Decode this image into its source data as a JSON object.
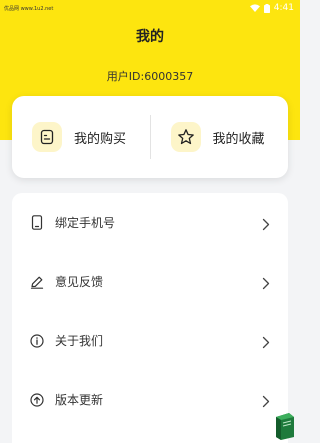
{
  "status_bar": {
    "left_text": "优品网 www.1u2.net",
    "time": "4:41"
  },
  "header": {
    "title": "我的",
    "user_id": "用户ID:6000357"
  },
  "quick_actions": [
    {
      "label": "我的购买",
      "icon": "purchase-icon"
    },
    {
      "label": "我的收藏",
      "icon": "star-icon"
    }
  ],
  "menu": [
    {
      "label": "绑定手机号",
      "icon": "phone-icon"
    },
    {
      "label": "意见反馈",
      "icon": "edit-icon"
    },
    {
      "label": "关于我们",
      "icon": "info-icon"
    },
    {
      "label": "版本更新",
      "icon": "upload-icon"
    }
  ],
  "colors": {
    "accent": "#fde50f",
    "icon_bg": "#fdf5c9",
    "background": "#f3f4f6"
  }
}
